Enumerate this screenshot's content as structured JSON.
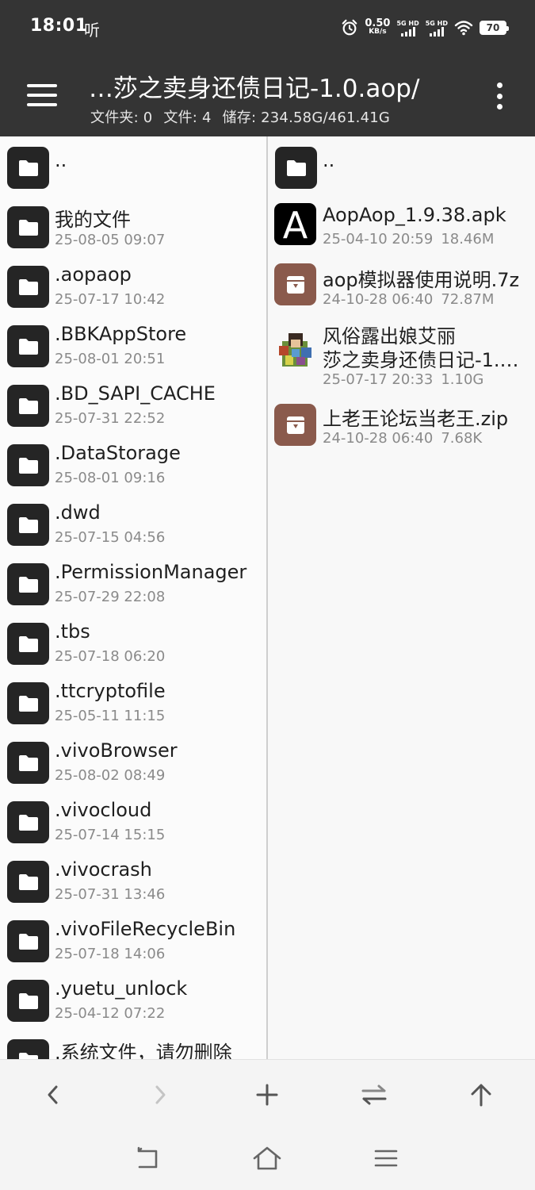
{
  "status_bar": {
    "time": "18:01",
    "note": "听",
    "net_speed_value": "0.50",
    "net_speed_unit": "KB/s",
    "sim1_label": "5G HD",
    "sim2_label": "5G HD",
    "battery": "70"
  },
  "header": {
    "title": "…莎之卖身还债日记-1.0.aop/",
    "folders_label": "文件夹: 0",
    "files_label": "文件: 4",
    "storage_label": "储存: 234.58G/461.41G"
  },
  "left_pane": {
    "parent": "..",
    "items": [
      {
        "name": " 我的文件",
        "date": "25-08-05 09:07"
      },
      {
        "name": ".aopaop",
        "date": "25-07-17 10:42"
      },
      {
        "name": ".BBKAppStore",
        "date": "25-08-01 20:51"
      },
      {
        "name": ".BD_SAPI_CACHE",
        "date": "25-07-31 22:52"
      },
      {
        "name": ".DataStorage",
        "date": "25-08-01 09:16"
      },
      {
        "name": ".dwd",
        "date": "25-07-15 04:56"
      },
      {
        "name": ".PermissionManager",
        "date": "25-07-29 22:08"
      },
      {
        "name": ".tbs",
        "date": "25-07-18 06:20"
      },
      {
        "name": ".ttcryptofile",
        "date": "25-05-11 11:15"
      },
      {
        "name": ".vivoBrowser",
        "date": "25-08-02 08:49"
      },
      {
        "name": ".vivocloud",
        "date": "25-07-14 15:15"
      },
      {
        "name": ".vivocrash",
        "date": "25-07-31 13:46"
      },
      {
        "name": ".vivoFileRecycleBin",
        "date": "25-07-18 14:06"
      },
      {
        "name": ".yuetu_unlock",
        "date": "25-04-12 07:22"
      },
      {
        "name": ".系统文件，请勿删除",
        "date": ""
      }
    ]
  },
  "right_pane": {
    "parent": "..",
    "files": [
      {
        "name": "AopAop_1.9.38.apk",
        "date": "25-04-10 20:59",
        "size": "18.46M",
        "icon": "apk-icon",
        "icon_glyph": "A"
      },
      {
        "name": "aop模拟器使用说明.7z",
        "date": "24-10-28 06:40",
        "size": "72.87M",
        "icon": "archive-icon"
      },
      {
        "name_line1": "风俗露出娘艾丽",
        "name_line2": "莎之卖身还债日记-1.…",
        "date": "25-07-17 20:33",
        "size": "1.10G",
        "icon": "game-icon"
      },
      {
        "name": "上老王论坛当老王.zip",
        "date": "24-10-28 06:40",
        "size": "7.68K",
        "icon": "archive-icon"
      }
    ]
  },
  "colors": {
    "header_bg": "#343434",
    "folder_icon_bg": "#252525",
    "archive_icon_bg": "#8a5a4c",
    "secondary_text": "#8a8a8a"
  },
  "toolbar": [
    "back-icon",
    "forward-icon",
    "add-icon",
    "swap-icon",
    "up-arrow-icon"
  ],
  "navbar": [
    "nav-back-icon",
    "home-icon",
    "recents-icon"
  ]
}
